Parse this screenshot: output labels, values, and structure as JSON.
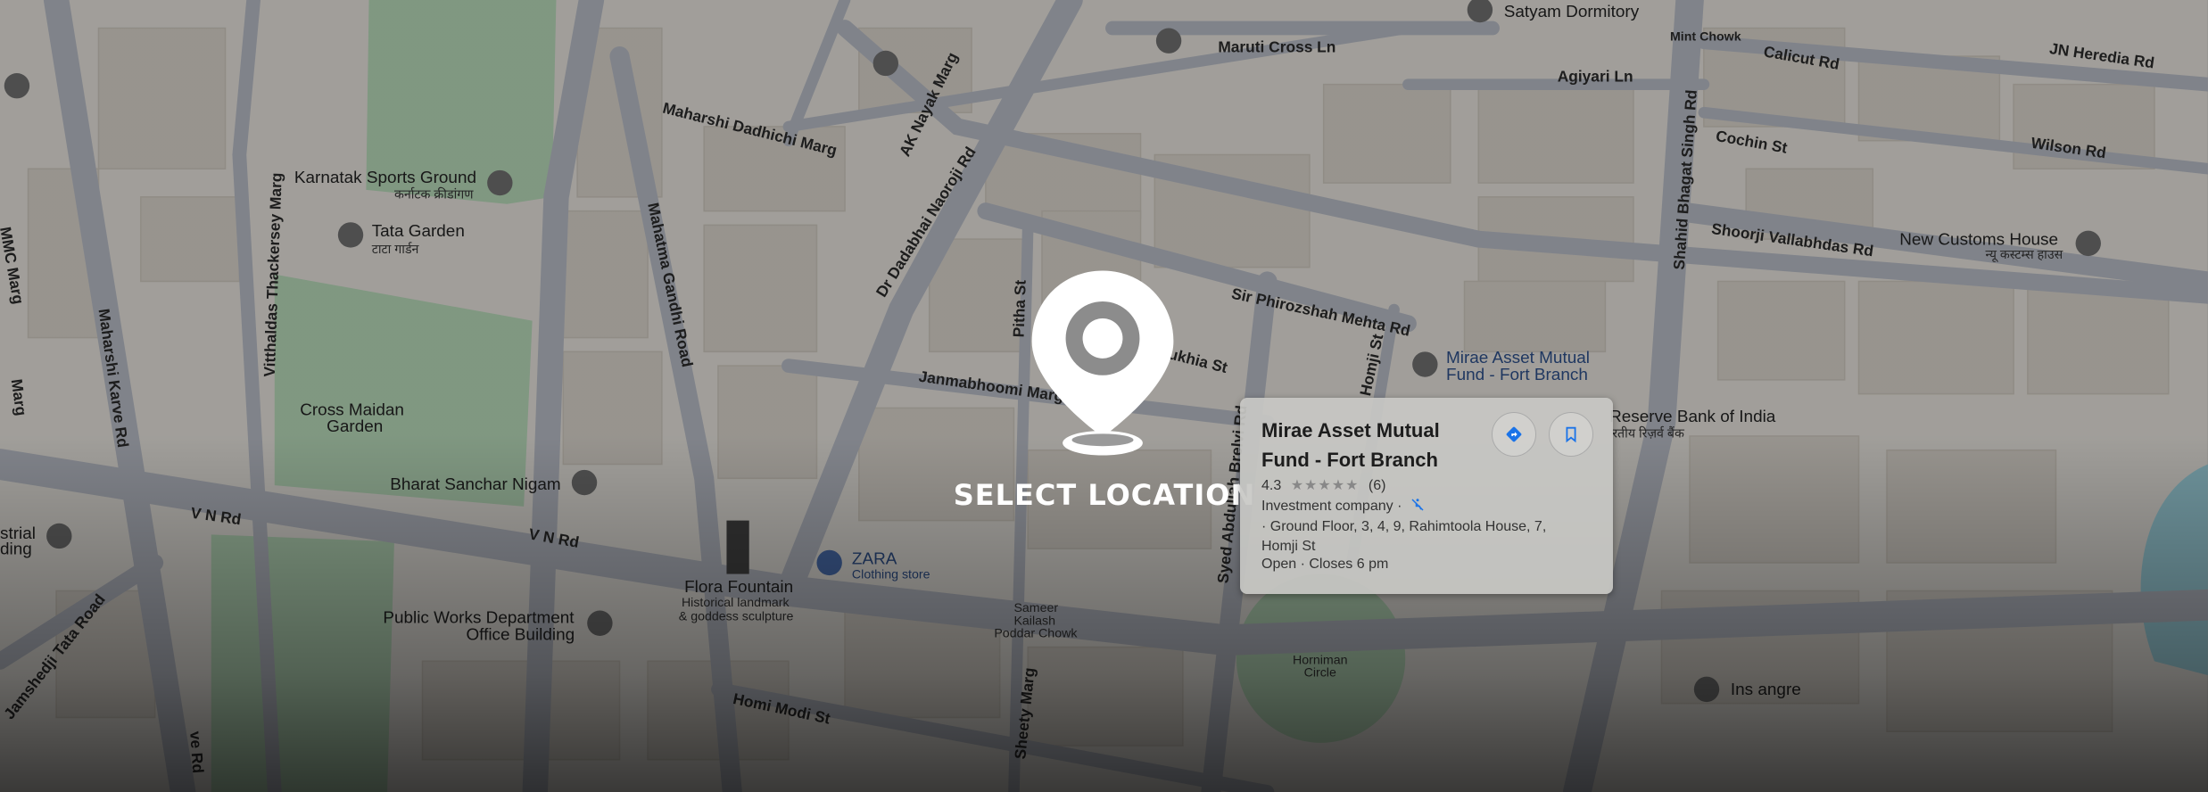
{
  "overlay": {
    "select_label": "SELECT LOCATION"
  },
  "colors": {
    "map_land": "#e6e3dd",
    "map_road": "#b8bcc6",
    "map_park": "#b7d9b9",
    "map_water": "#9ed3df",
    "map_building": "#d9d4cc",
    "accent_blue": "#1a73e8",
    "shade": "#000000"
  },
  "place_card": {
    "title_line1": "Mirae Asset Mutual",
    "title_line2": "Fund - Fort Branch",
    "rating": "4.3",
    "stars": "★★★★★",
    "review_count": "(6)",
    "category": "Investment company ·",
    "address_line1": "· Ground Floor, 3, 4, 9, Rahimtoola House, 7,",
    "address_line2": "Homji St",
    "hours_status": "Open",
    "hours_detail": "· Closes 6 pm",
    "directions_icon": "directions-icon",
    "save_icon": "bookmark-icon"
  },
  "map": {
    "roads": {
      "maharshi_dadhichi": "Maharshi Dadhichi Marg",
      "ak_nayak": "AK Nayak Marg",
      "dr_dadabhai": "Dr Dadabhai Naoroji Rd",
      "mahatma_gandhi": "Mahatma Gandhi Road",
      "vitthaldas": "Vitthaldas Thackersey Marg",
      "maharshi_karve": "Maharshi Karve Rd",
      "vn_rd_1": "V N Rd",
      "vn_rd_2": "V N Rd",
      "janmabhoomi": "Janmabhoomi Marg",
      "pitha": "Pitha St",
      "sukhia": "Sukhia St",
      "sir_phirozshah": "Sir Phirozshah Mehta Rd",
      "homji": "Homji St",
      "syed_abdullah": "Syed Abdullah Brelvi Rd",
      "maruti_cross": "Maruti Cross Ln",
      "agiyari": "Agiyari Ln",
      "shahid_bhagat": "Shahid Bhagat Singh Rd",
      "calicut": "Calicut Rd",
      "jn_heredia": "JN Heredia Rd",
      "cochin": "Cochin St",
      "wilson": "Wilson Rd",
      "shoorji": "Shoorji Vallabhdas Rd",
      "jamshedji": "Jamshedji Tata Road",
      "homi_modi": "Homi Modi St",
      "sheety": "Sheety Marg",
      "mint_chowk": "Mint Chowk",
      "mmc": "MMC Marg",
      "marg_left": "Marg",
      "rd_left": "ve Rd"
    },
    "places": {
      "satyam": "Satyam Dormitory",
      "karnatak": "Karnatak Sports Ground",
      "karnatak_hi": "कर्नाटक क्रीडांगण",
      "tata_garden": "Tata Garden",
      "tata_garden_hi": "टाटा गार्डन",
      "cross_maidan_1": "Cross Maidan",
      "cross_maidan_2": "Garden",
      "bharat": "Bharat Sanchar Nigam",
      "flora": "Flora Fountain",
      "flora_sub1": "Historical landmark",
      "flora_sub2": "& goddess sculpture",
      "zara": "ZARA",
      "zara_sub": "Clothing store",
      "pwd_1": "Public Works Department",
      "pwd_2": "Office Building",
      "sameer_1": "Sameer",
      "sameer_2": "Kailash",
      "sameer_3": "Poddar Chowk",
      "horniman_1": "Horniman",
      "horniman_2": "Circle",
      "mirae_1": "Mirae Asset Mutual",
      "mirae_2": "Fund - Fort Branch",
      "rbi": "Reserve Bank of India",
      "rbi_hi": "रतीय रिज़र्व बैंक",
      "new_customs": "New Customs House",
      "new_customs_hi": "न्यू कस्टम्स हाउस",
      "ins_angre": "Ins angre",
      "strial": "strial",
      "ding": "ding"
    }
  }
}
